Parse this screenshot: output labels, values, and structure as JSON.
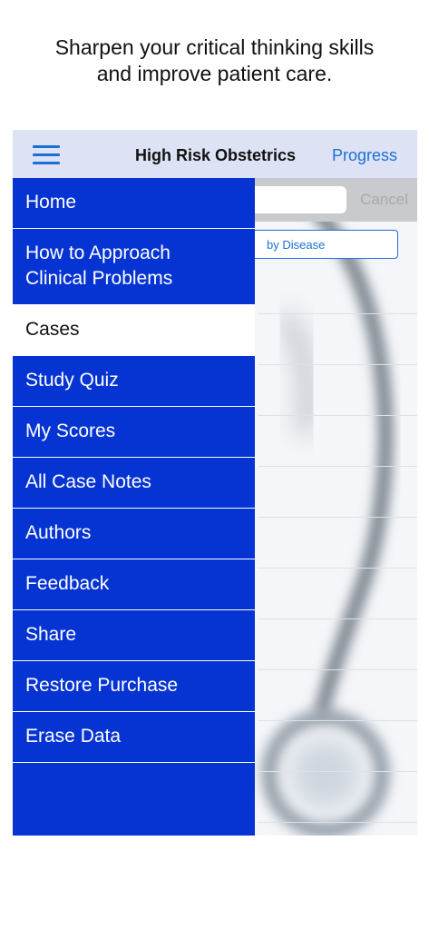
{
  "caption": {
    "line1": "Sharpen your critical thinking skills",
    "line2": "and improve patient care."
  },
  "navbar": {
    "title": "High Risk Obstetrics",
    "right_button": "Progress",
    "menu_icon": "hamburger-icon"
  },
  "search": {
    "cancel_label": "Cancel"
  },
  "segment": {
    "visible_label": "by Disease"
  },
  "menu": {
    "items": [
      {
        "label": "Home"
      },
      {
        "label_line1": "How to Approach",
        "label_line2": "Clinical Problems"
      },
      {
        "label": "Cases"
      },
      {
        "label": "Study Quiz"
      },
      {
        "label": "My Scores"
      },
      {
        "label": "All Case Notes"
      },
      {
        "label": "Authors"
      },
      {
        "label": "Feedback"
      },
      {
        "label": "Share"
      },
      {
        "label": "Restore Purchase"
      },
      {
        "label": "Erase Data"
      }
    ],
    "active_item": "Cases"
  },
  "colors": {
    "menu_background": "#0634d3",
    "accent": "#1b6fd6",
    "navbar_background": "#dde3f4"
  }
}
